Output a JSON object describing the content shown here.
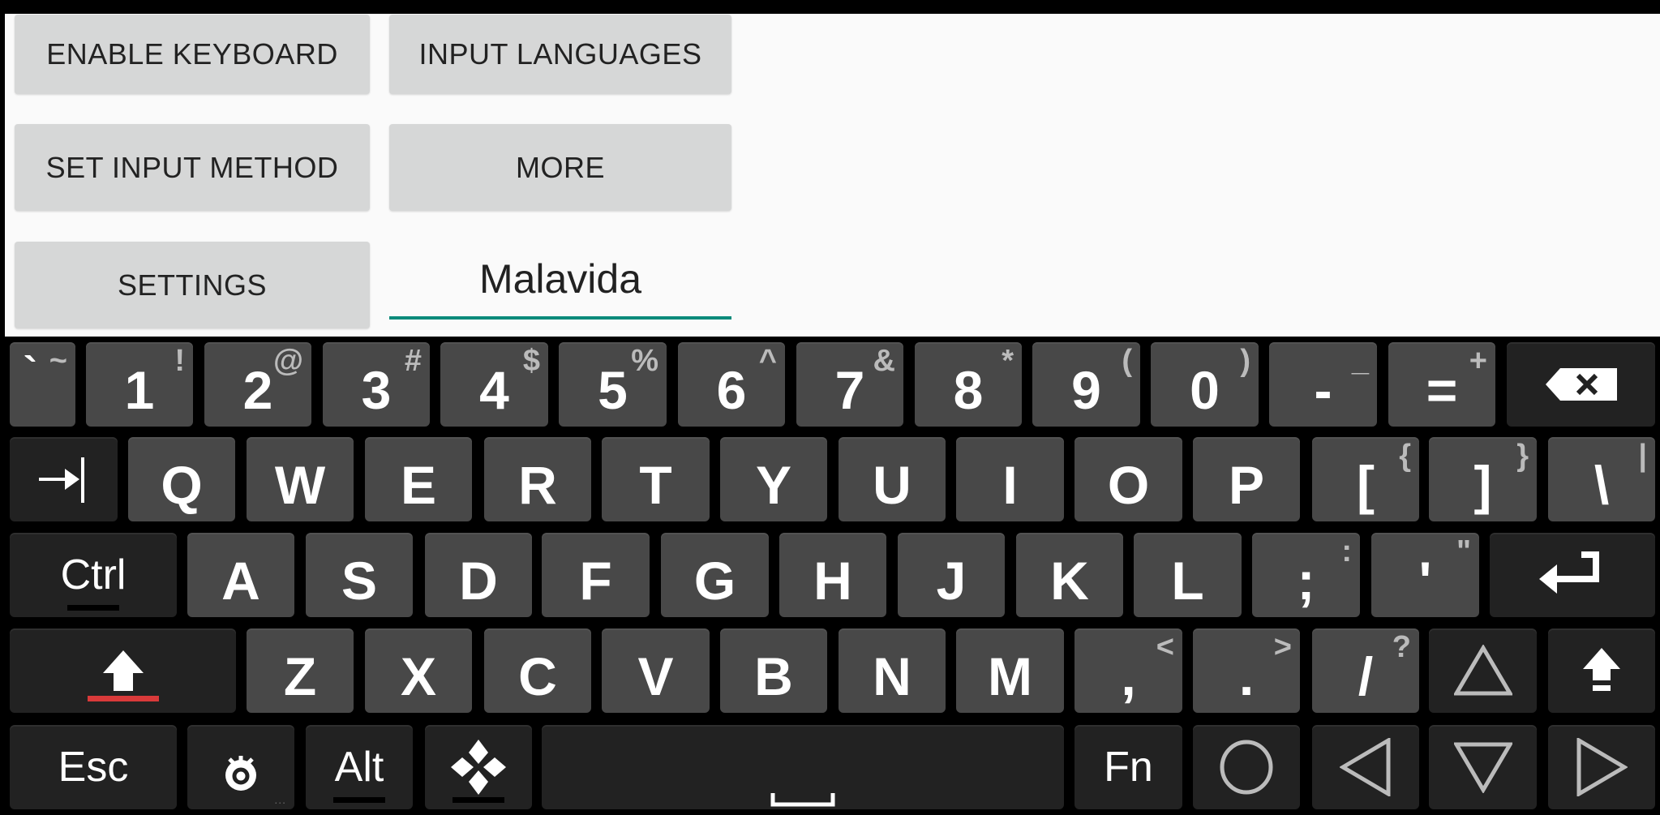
{
  "buttons": {
    "enable_keyboard": "ENABLE KEYBOARD",
    "input_languages": "INPUT LANGUAGES",
    "set_input_method": "SET INPUT METHOD",
    "more": "MORE",
    "settings": "SETTINGS"
  },
  "text_field": {
    "value": "Malavida"
  },
  "colors": {
    "accent": "#0b8a7a",
    "shift_indicator": "#d93a3a",
    "key": "#484848",
    "modifier_key": "#222222",
    "panel": "#fafafa",
    "button": "#d6d7d7"
  },
  "keyboard": {
    "rows": [
      [
        {
          "name": "backtick",
          "main": "`",
          "alt": "~"
        },
        {
          "name": "1",
          "main": "1",
          "alt": "!"
        },
        {
          "name": "2",
          "main": "2",
          "alt": "@"
        },
        {
          "name": "3",
          "main": "3",
          "alt": "#"
        },
        {
          "name": "4",
          "main": "4",
          "alt": "$"
        },
        {
          "name": "5",
          "main": "5",
          "alt": "%"
        },
        {
          "name": "6",
          "main": "6",
          "alt": "^"
        },
        {
          "name": "7",
          "main": "7",
          "alt": "&"
        },
        {
          "name": "8",
          "main": "8",
          "alt": "*"
        },
        {
          "name": "9",
          "main": "9",
          "alt": "("
        },
        {
          "name": "0",
          "main": "0",
          "alt": ")"
        },
        {
          "name": "minus",
          "main": "-",
          "alt": "_"
        },
        {
          "name": "equals",
          "main": "=",
          "alt": "+"
        },
        {
          "name": "backspace",
          "icon": "backspace-icon",
          "dark": true
        }
      ],
      [
        {
          "name": "tab",
          "icon": "tab-icon",
          "dark": true
        },
        {
          "name": "q",
          "main": "Q"
        },
        {
          "name": "w",
          "main": "W"
        },
        {
          "name": "e",
          "main": "E"
        },
        {
          "name": "r",
          "main": "R"
        },
        {
          "name": "t",
          "main": "T"
        },
        {
          "name": "y",
          "main": "Y"
        },
        {
          "name": "u",
          "main": "U"
        },
        {
          "name": "i",
          "main": "I"
        },
        {
          "name": "o",
          "main": "O"
        },
        {
          "name": "p",
          "main": "P"
        },
        {
          "name": "left-bracket",
          "main": "[",
          "alt": "{"
        },
        {
          "name": "right-bracket",
          "main": "]",
          "alt": "}"
        },
        {
          "name": "backslash",
          "main": "\\",
          "alt": "|"
        }
      ],
      [
        {
          "name": "ctrl",
          "main": "Ctrl",
          "dark": true,
          "indicator": true
        },
        {
          "name": "a",
          "main": "A"
        },
        {
          "name": "s",
          "main": "S"
        },
        {
          "name": "d",
          "main": "D"
        },
        {
          "name": "f",
          "main": "F"
        },
        {
          "name": "g",
          "main": "G"
        },
        {
          "name": "h",
          "main": "H"
        },
        {
          "name": "j",
          "main": "J"
        },
        {
          "name": "k",
          "main": "K"
        },
        {
          "name": "l",
          "main": "L"
        },
        {
          "name": "semicolon",
          "main": ";",
          "alt": ":"
        },
        {
          "name": "quote",
          "main": "'",
          "alt": "\""
        },
        {
          "name": "enter",
          "icon": "enter-icon",
          "dark": true
        }
      ],
      [
        {
          "name": "shift",
          "icon": "shift-icon",
          "dark": true,
          "red_indicator": true
        },
        {
          "name": "z",
          "main": "Z"
        },
        {
          "name": "x",
          "main": "X"
        },
        {
          "name": "c",
          "main": "C"
        },
        {
          "name": "v",
          "main": "V"
        },
        {
          "name": "b",
          "main": "B"
        },
        {
          "name": "n",
          "main": "N"
        },
        {
          "name": "m",
          "main": "M"
        },
        {
          "name": "comma",
          "main": ",",
          "alt": "<"
        },
        {
          "name": "period",
          "main": ".",
          "alt": ">"
        },
        {
          "name": "slash",
          "main": "/",
          "alt": "?"
        },
        {
          "name": "arrow-up",
          "icon": "triangle-up-icon",
          "dark": true
        },
        {
          "name": "shift-lock",
          "icon": "shift-lock-icon",
          "dark": true
        }
      ],
      [
        {
          "name": "esc",
          "main": "Esc",
          "dark": true
        },
        {
          "name": "settings",
          "icon": "gear-icon",
          "dark": true,
          "dots": "..."
        },
        {
          "name": "alt",
          "main": "Alt",
          "dark": true,
          "indicator": true
        },
        {
          "name": "dpad",
          "icon": "dpad-icon",
          "dark": true,
          "indicator": true
        },
        {
          "name": "space",
          "icon": "space-icon",
          "dark": true
        },
        {
          "name": "fn",
          "main": "Fn",
          "dark": true
        },
        {
          "name": "home",
          "icon": "circle-icon",
          "dark": true
        },
        {
          "name": "arrow-left",
          "icon": "triangle-left-icon",
          "dark": true
        },
        {
          "name": "arrow-down",
          "icon": "triangle-down-icon",
          "dark": true
        },
        {
          "name": "arrow-right",
          "icon": "triangle-right-icon",
          "dark": true
        }
      ]
    ]
  }
}
